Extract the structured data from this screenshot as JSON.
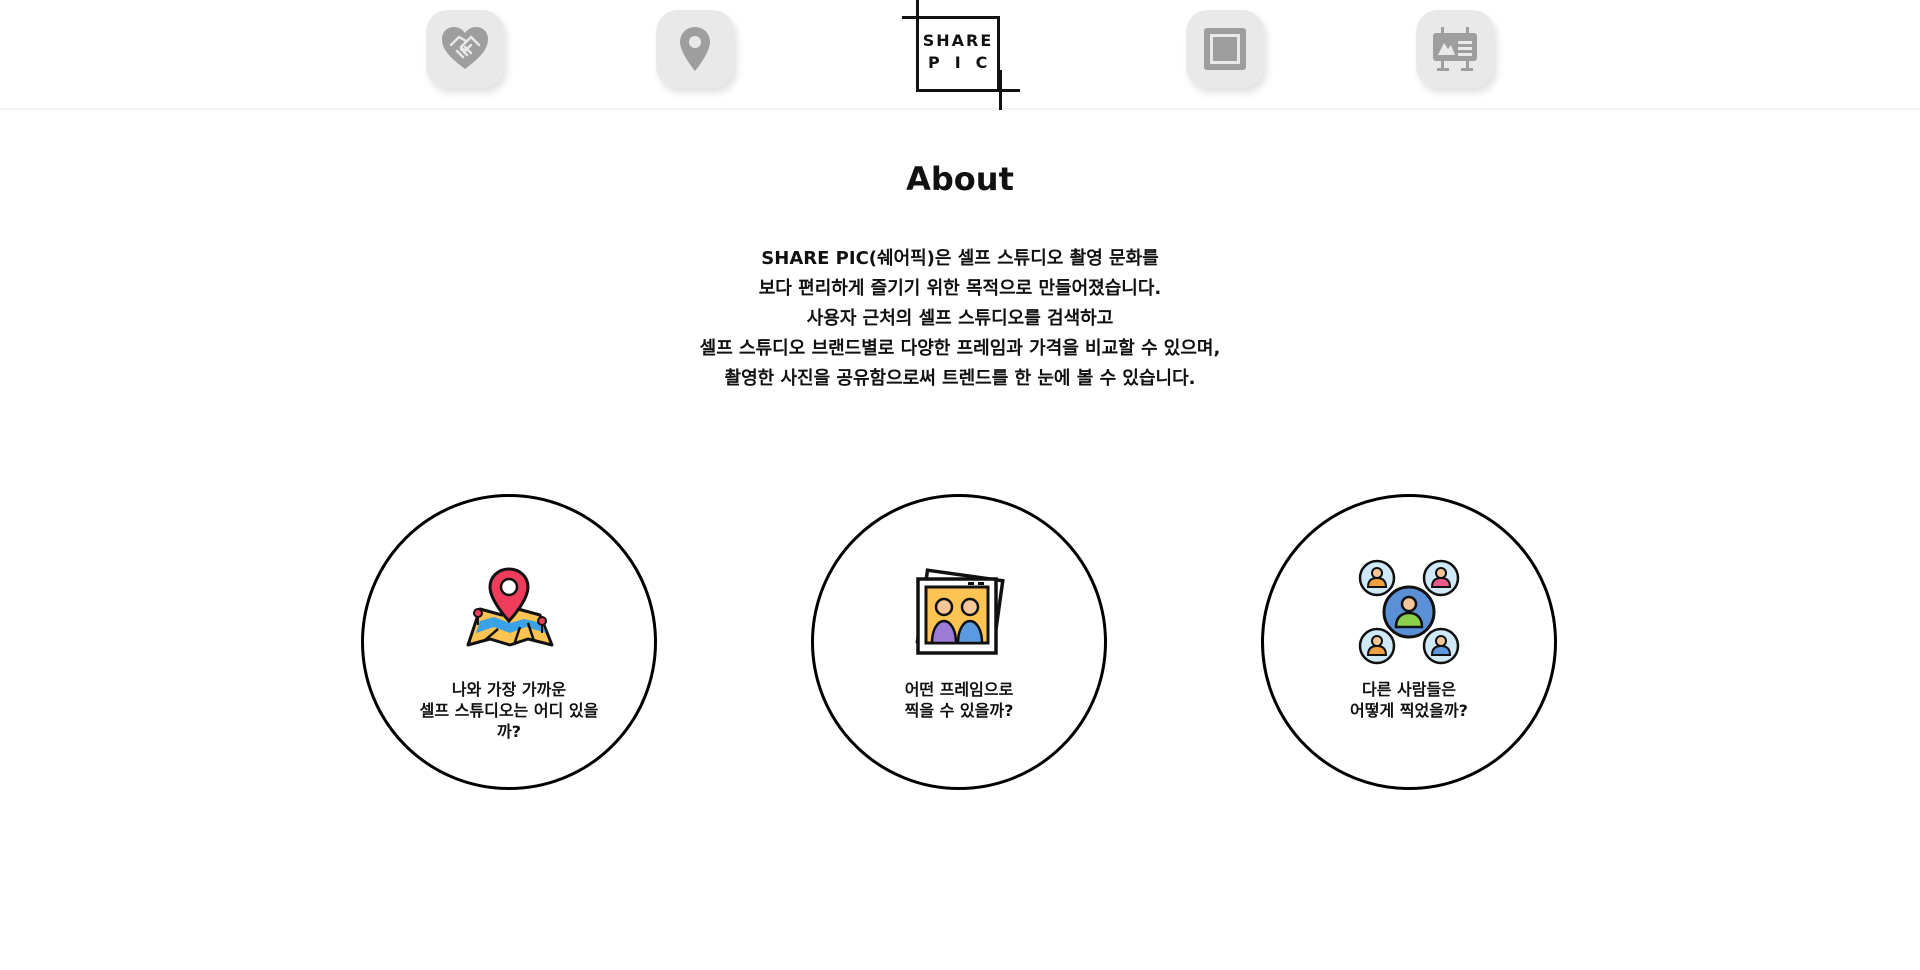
{
  "header": {
    "logo": {
      "line1": "SHARE",
      "line2": "PIC"
    },
    "nav": [
      {
        "icon": "handshake-heart-icon"
      },
      {
        "icon": "map-pin-icon"
      },
      {
        "icon": "picture-frame-icon"
      },
      {
        "icon": "billboard-icon"
      }
    ],
    "colors": {
      "nav_bg": "#e9e9e9",
      "nav_icon": "#9e9e9e"
    }
  },
  "about": {
    "title": "About",
    "lines": [
      "SHARE PIC(쉐어픽)은 셀프 스튜디오 촬영 문화를",
      "보다 편리하게 즐기기 위한 목적으로 만들어졌습니다.",
      "사용자 근처의 셀프 스튜디오를 검색하고",
      "셀프 스튜디오 브랜드별로 다양한 프레임과 가격을 비교할 수 있으며,",
      "촬영한 사진을 공유함으로써 트렌드를 한 눈에 볼 수 있습니다."
    ]
  },
  "features": [
    {
      "icon": "map-location-icon",
      "line1": "나와 가장 가까운",
      "line2": "셀프 스튜디오는 어디 있을",
      "line3": "까?"
    },
    {
      "icon": "photo-frames-icon",
      "line1": "어떤 프레임으로",
      "line2": "찍을 수 있을까?"
    },
    {
      "icon": "people-network-icon",
      "line1": "다른 사람들은",
      "line2": "어떻게 찍었을까?"
    }
  ]
}
